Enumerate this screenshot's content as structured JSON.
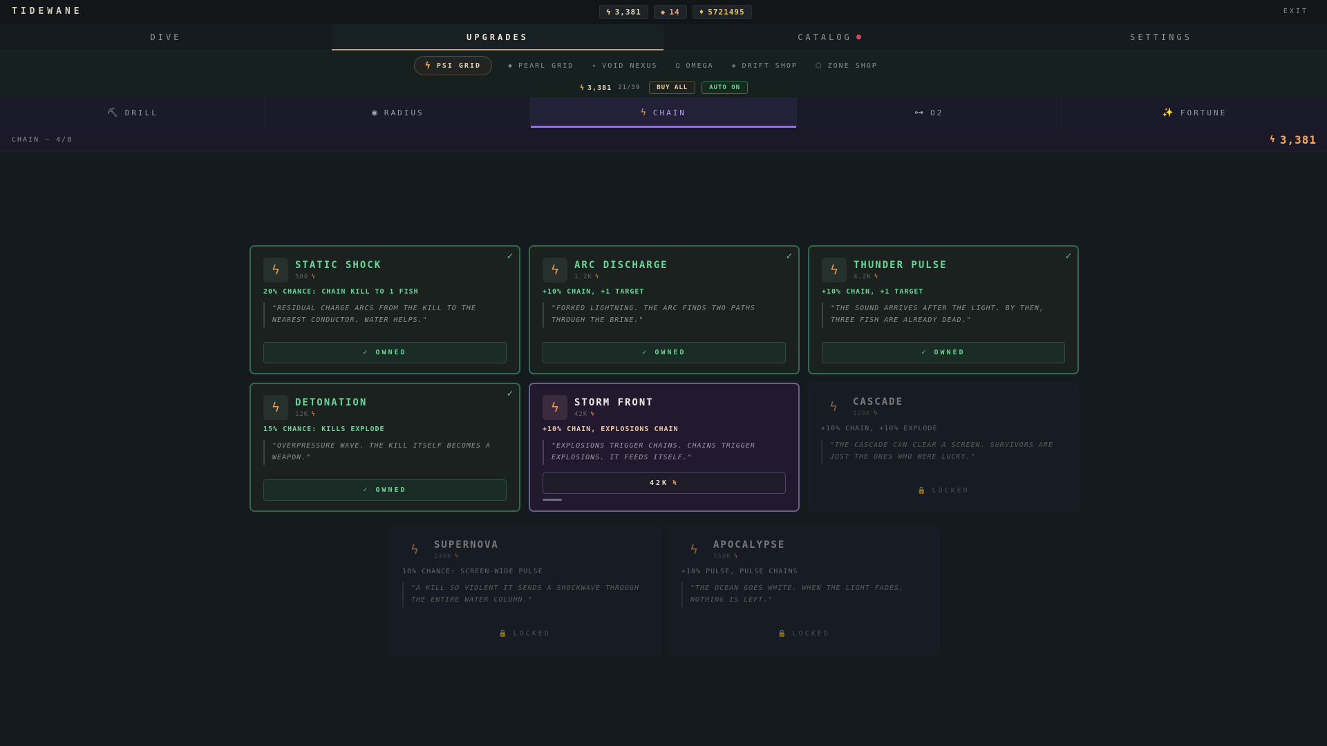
{
  "app": {
    "title": "TIDEWANE",
    "exit_label": "EXIT"
  },
  "resources": [
    {
      "name": "psi",
      "glyph": "lightning-icon",
      "value": "3,381",
      "color": "#e8d2b8"
    },
    {
      "name": "pearl",
      "glyph": "pearl-icon",
      "value": "14",
      "color": "#e4a17a"
    },
    {
      "name": "gold",
      "glyph": "gold-icon",
      "value": "5721495",
      "color": "#e8c65c"
    }
  ],
  "main_tabs": [
    {
      "label": "DIVE",
      "active": false
    },
    {
      "label": "UPGRADES",
      "active": true
    },
    {
      "label": "CATALOG",
      "active": false,
      "badge": true
    },
    {
      "label": "SETTINGS",
      "active": false
    }
  ],
  "sub_tabs": [
    {
      "label": "PSI GRID",
      "icon": "lightning-icon",
      "active": true
    },
    {
      "label": "PEARL GRID",
      "icon": "diamond-icon",
      "active": false
    },
    {
      "label": "VOID NEXUS",
      "icon": "sparkle-icon",
      "active": false
    },
    {
      "label": "OMEGA",
      "icon": "omega-icon",
      "active": false
    },
    {
      "label": "DRIFT SHOP",
      "icon": "dot-icon",
      "active": false
    },
    {
      "label": "ZONE SHOP",
      "icon": "hexagon-icon",
      "active": false
    }
  ],
  "toolbar": {
    "balance": "3,381",
    "count": "21/39",
    "buy_all": "BUY ALL",
    "auto": "AUTO ON"
  },
  "categories": [
    {
      "label": "DRILL",
      "icon": "pickaxe-icon",
      "active": false
    },
    {
      "label": "RADIUS",
      "icon": "target-icon",
      "active": false
    },
    {
      "label": "CHAIN",
      "icon": "lightning-icon",
      "active": true
    },
    {
      "label": "O2",
      "icon": "o2-icon",
      "active": false
    },
    {
      "label": "FORTUNE",
      "icon": "sparkles-icon",
      "active": false
    }
  ],
  "section": {
    "title": "CHAIN — 4/8",
    "total": "3,381"
  },
  "accent": {
    "psi": "#f09a4a",
    "owned": "#6cd69a",
    "active_tab": "#8d73e0"
  },
  "cards": [
    {
      "name": "STATIC SHOCK",
      "cost": "500",
      "effect": "20% CHANCE: CHAIN KILL TO 1 FISH",
      "quote": "\"RESIDUAL CHARGE ARCS FROM THE KILL TO THE NEAREST CONDUCTOR. WATER HELPS.\"",
      "state": "owned",
      "button": "✓ OWNED"
    },
    {
      "name": "ARC DISCHARGE",
      "cost": "1.2K",
      "effect": "+10% CHAIN, +1 TARGET",
      "quote": "\"FORKED LIGHTNING. THE ARC FINDS TWO PATHS THROUGH THE BRINE.\"",
      "state": "owned",
      "button": "✓ OWNED"
    },
    {
      "name": "THUNDER PULSE",
      "cost": "4.2K",
      "effect": "+10% CHAIN, +1 TARGET",
      "quote": "\"THE SOUND ARRIVES AFTER THE LIGHT. BY THEN, THREE FISH ARE ALREADY DEAD.\"",
      "state": "owned",
      "button": "✓ OWNED"
    },
    {
      "name": "DETONATION",
      "cost": "12K",
      "effect": "15% CHANCE: KILLS EXPLODE",
      "quote": "\"OVERPRESSURE WAVE. THE KILL ITSELF BECOMES A WEAPON.\"",
      "state": "owned",
      "button": "✓ OWNED"
    },
    {
      "name": "STORM FRONT",
      "cost": "42K",
      "effect": "+10% CHAIN, EXPLOSIONS CHAIN",
      "quote": "\"EXPLOSIONS TRIGGER CHAINS. CHAINS TRIGGER EXPLOSIONS. IT FEEDS ITSELF.\"",
      "state": "available",
      "button": "42K",
      "progress": 0.08
    },
    {
      "name": "CASCADE",
      "cost": "120K",
      "effect": "+10% CHAIN, +10% EXPLODE",
      "quote": "\"THE CASCADE CAN CLEAR A SCREEN. SURVIVORS ARE JUST THE ONES WHO WERE LUCKY.\"",
      "state": "locked",
      "button": "LOCKED"
    },
    {
      "name": "SUPERNOVA",
      "cost": "240K",
      "effect": "10% CHANCE: SCREEN-WIDE PULSE",
      "quote": "\"A KILL SO VIOLENT IT SENDS A SHOCKWAVE THROUGH THE ENTIRE WATER COLUMN.\"",
      "state": "locked",
      "button": "LOCKED"
    },
    {
      "name": "APOCALYPSE",
      "cost": "550K",
      "effect": "+10% PULSE, PULSE CHAINS",
      "quote": "\"THE OCEAN GOES WHITE. WHEN THE LIGHT FADES, NOTHING IS LEFT.\"",
      "state": "locked",
      "button": "LOCKED"
    }
  ]
}
